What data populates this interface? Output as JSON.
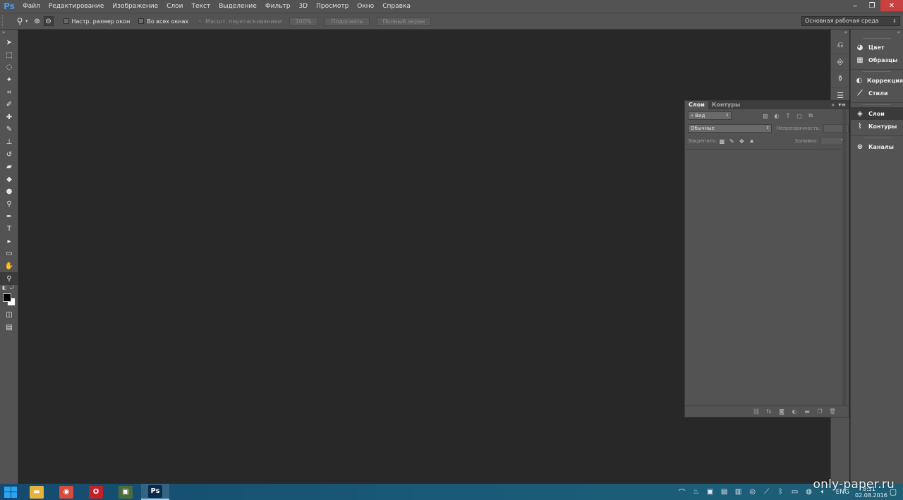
{
  "app": {
    "logo_text": "Ps"
  },
  "menu": {
    "items": [
      "Файл",
      "Редактирование",
      "Изображение",
      "Слои",
      "Текст",
      "Выделение",
      "Фильтр",
      "3D",
      "Просмотр",
      "Окно",
      "Справка"
    ]
  },
  "window_controls": {
    "minimize": "‒",
    "restore": "❐",
    "close": "✕"
  },
  "options_bar": {
    "resize_windows_label": "Настр. размер окон",
    "all_windows_label": "Во всех окнах",
    "scrubby_zoom_label": "Масшт. перетаскиванием",
    "zoom_100_label": "100%",
    "fit_screen_label": "Подогнать",
    "fill_screen_label": "Полный экран",
    "workspace_value": "Основная рабочая среда"
  },
  "tools": [
    {
      "name": "move-tool",
      "glyph": "➤"
    },
    {
      "name": "rectangular-marquee-tool",
      "glyph": "⬚"
    },
    {
      "name": "lasso-tool",
      "glyph": "◌"
    },
    {
      "name": "magic-wand-tool",
      "glyph": "✦"
    },
    {
      "name": "crop-tool",
      "glyph": "⌗"
    },
    {
      "name": "eyedropper-tool",
      "glyph": "✐"
    },
    {
      "name": "spot-healing-tool",
      "glyph": "✚"
    },
    {
      "name": "brush-tool",
      "glyph": "✎"
    },
    {
      "name": "clone-stamp-tool",
      "glyph": "⊥"
    },
    {
      "name": "history-brush-tool",
      "glyph": "↺"
    },
    {
      "name": "eraser-tool",
      "glyph": "▰"
    },
    {
      "name": "paint-bucket-tool",
      "glyph": "◆"
    },
    {
      "name": "blur-tool",
      "glyph": "●"
    },
    {
      "name": "dodge-tool",
      "glyph": "⚲"
    },
    {
      "name": "pen-tool",
      "glyph": "✒"
    },
    {
      "name": "type-tool",
      "glyph": "T"
    },
    {
      "name": "path-selection-tool",
      "glyph": "▸"
    },
    {
      "name": "rectangle-shape-tool",
      "glyph": "▭"
    },
    {
      "name": "hand-tool",
      "glyph": "✋"
    },
    {
      "name": "zoom-tool",
      "glyph": "⚲"
    }
  ],
  "colors": {
    "foreground": "#000000",
    "background": "#ffffff",
    "canvas": "#282828",
    "panel": "#535353"
  },
  "right_dock": {
    "groups": [
      {
        "items": [
          {
            "label": "Цвет",
            "icon": "palette-icon",
            "glyph": "◕"
          },
          {
            "label": "Образцы",
            "icon": "swatches-icon",
            "glyph": "▦"
          }
        ]
      },
      {
        "items": [
          {
            "label": "Коррекция",
            "icon": "adjustments-icon",
            "glyph": "◐"
          },
          {
            "label": "Стили",
            "icon": "styles-icon",
            "glyph": "⟋"
          }
        ]
      },
      {
        "items": [
          {
            "label": "Слои",
            "icon": "layers-icon",
            "glyph": "◈",
            "active": true
          },
          {
            "label": "Контуры",
            "icon": "paths-icon",
            "glyph": "⌇"
          }
        ]
      },
      {
        "items": [
          {
            "label": "Каналы",
            "icon": "channels-icon",
            "glyph": "⊛"
          }
        ]
      }
    ]
  },
  "layers_panel": {
    "tabs": [
      "Слои",
      "Контуры"
    ],
    "filter_value": "⌕ Вид",
    "blend_mode": "Обычные",
    "opacity_label": "Непрозрачность:",
    "lock_label": "Закрепить:",
    "fill_label": "Заливка:"
  },
  "taskbar": {
    "apps": [
      {
        "name": "file-explorer",
        "glyph": "▬",
        "color": "#e8b23a"
      },
      {
        "name": "chrome",
        "glyph": "◉",
        "color": "#d64b3b"
      },
      {
        "name": "opera",
        "glyph": "O",
        "color": "#c4202a"
      },
      {
        "name": "media-app",
        "glyph": "▣",
        "color": "#4c6b3c"
      },
      {
        "name": "photoshop",
        "glyph": "Ps",
        "color": "#0c2a4a"
      }
    ],
    "lang": "ENG",
    "time": "8:51",
    "date": "02.08.2016"
  },
  "watermark": "only-paper.ru"
}
